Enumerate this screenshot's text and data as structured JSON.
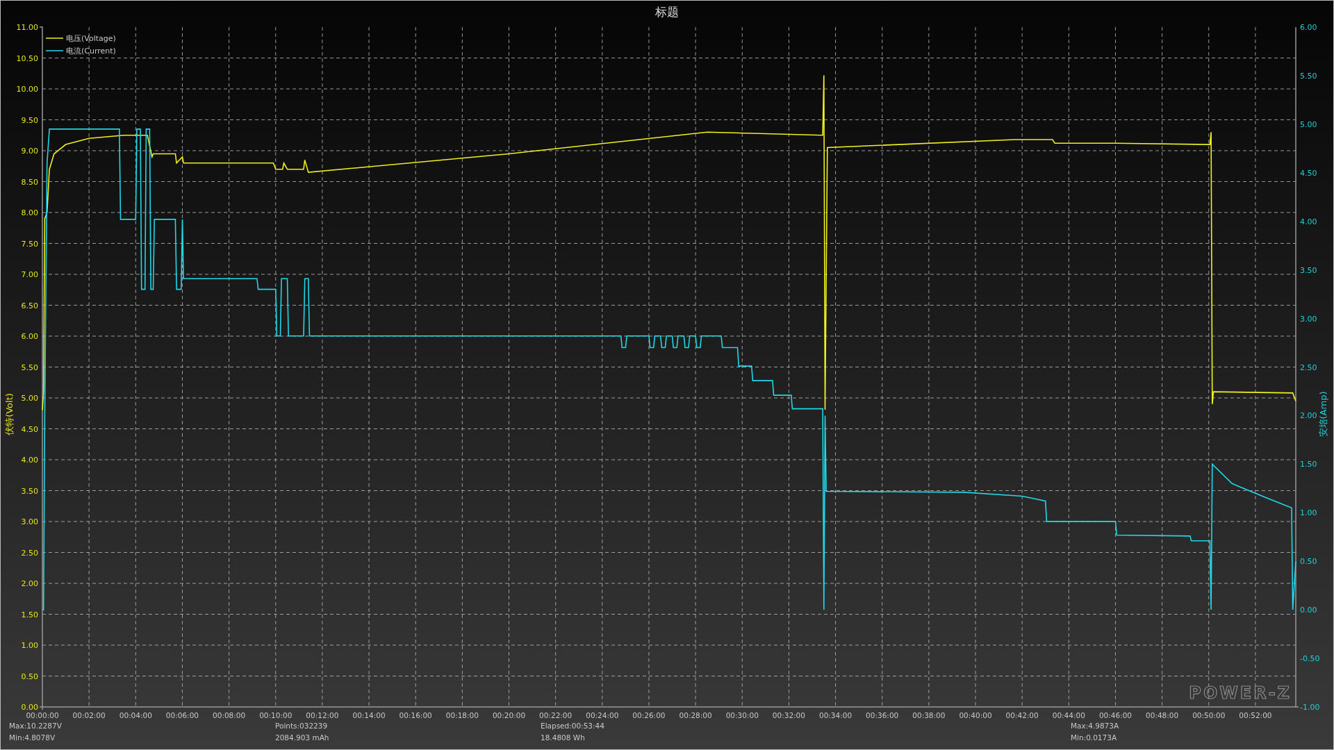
{
  "title": "标题",
  "chart": {
    "chart_data": {
      "type": "line",
      "grid": true,
      "legend": "top-left",
      "ylabel": "伏特(Volt)",
      "y2label": "安培(Amp)",
      "xlim": [
        0,
        53.73
      ],
      "ylim": [
        0,
        11
      ],
      "y2lim": [
        -1,
        6
      ],
      "xticks": [
        {
          "value": 0,
          "label": "00:00:00"
        },
        {
          "value": 2,
          "label": "00:02:00"
        },
        {
          "value": 4,
          "label": "00:04:00"
        },
        {
          "value": 6,
          "label": "00:06:00"
        },
        {
          "value": 8,
          "label": "00:08:00"
        },
        {
          "value": 10,
          "label": "00:10:00"
        },
        {
          "value": 12,
          "label": "00:12:00"
        },
        {
          "value": 14,
          "label": "00:14:00"
        },
        {
          "value": 16,
          "label": "00:16:00"
        },
        {
          "value": 18,
          "label": "00:18:00"
        },
        {
          "value": 20,
          "label": "00:20:00"
        },
        {
          "value": 22,
          "label": "00:22:00"
        },
        {
          "value": 24,
          "label": "00:24:00"
        },
        {
          "value": 26,
          "label": "00:26:00"
        },
        {
          "value": 28,
          "label": "00:28:00"
        },
        {
          "value": 30,
          "label": "00:30:00"
        },
        {
          "value": 32,
          "label": "00:32:00"
        },
        {
          "value": 34,
          "label": "00:34:00"
        },
        {
          "value": 36,
          "label": "00:36:00"
        },
        {
          "value": 38,
          "label": "00:38:00"
        },
        {
          "value": 40,
          "label": "00:40:00"
        },
        {
          "value": 42,
          "label": "00:42:00"
        },
        {
          "value": 44,
          "label": "00:44:00"
        },
        {
          "value": 46,
          "label": "00:46:00"
        },
        {
          "value": 48,
          "label": "00:48:00"
        },
        {
          "value": 50,
          "label": "00:50:00"
        },
        {
          "value": 52,
          "label": "00:52:00"
        }
      ],
      "yticks": [
        {
          "value": 0,
          "label": "0.00"
        },
        {
          "value": 0.5,
          "label": "0.50"
        },
        {
          "value": 1,
          "label": "1.00"
        },
        {
          "value": 1.5,
          "label": "1.50"
        },
        {
          "value": 2,
          "label": "2.00"
        },
        {
          "value": 2.5,
          "label": "2.50"
        },
        {
          "value": 3,
          "label": "3.00"
        },
        {
          "value": 3.5,
          "label": "3.50"
        },
        {
          "value": 4,
          "label": "4.00"
        },
        {
          "value": 4.5,
          "label": "4.50"
        },
        {
          "value": 5,
          "label": "5.00"
        },
        {
          "value": 5.5,
          "label": "5.50"
        },
        {
          "value": 6,
          "label": "6.00"
        },
        {
          "value": 6.5,
          "label": "6.50"
        },
        {
          "value": 7,
          "label": "7.00"
        },
        {
          "value": 7.5,
          "label": "7.50"
        },
        {
          "value": 8,
          "label": "8.00"
        },
        {
          "value": 8.5,
          "label": "8.50"
        },
        {
          "value": 9,
          "label": "9.00"
        },
        {
          "value": 9.5,
          "label": "9.50"
        },
        {
          "value": 10,
          "label": "10.00"
        },
        {
          "value": 10.5,
          "label": "10.50"
        },
        {
          "value": 11,
          "label": "11.00"
        }
      ],
      "y2ticks": [
        {
          "value": -1,
          "label": "-1.00"
        },
        {
          "value": -0.5,
          "label": "-0.50"
        },
        {
          "value": 0,
          "label": "0.00"
        },
        {
          "value": 0.5,
          "label": "0.50"
        },
        {
          "value": 1,
          "label": "1.00"
        },
        {
          "value": 1.5,
          "label": "1.50"
        },
        {
          "value": 2,
          "label": "2.00"
        },
        {
          "value": 2.5,
          "label": "2.50"
        },
        {
          "value": 3,
          "label": "3.00"
        },
        {
          "value": 3.5,
          "label": "3.50"
        },
        {
          "value": 4,
          "label": "4.00"
        },
        {
          "value": 4.5,
          "label": "4.50"
        },
        {
          "value": 5,
          "label": "5.00"
        },
        {
          "value": 5.5,
          "label": "5.50"
        },
        {
          "value": 6,
          "label": "6.00"
        }
      ],
      "series": [
        {
          "name": "电压(Voltage)",
          "color": "#f0f020",
          "axis": "y",
          "x": [
            0,
            0.05,
            0.1,
            0.2,
            0.3,
            0.5,
            1,
            2,
            3.5,
            4.4,
            4.5,
            4.7,
            4.75,
            5.7,
            5.75,
            6,
            6.05,
            9.9,
            10,
            10.3,
            10.35,
            10.5,
            11.2,
            11.25,
            11.4,
            20,
            28.5,
            33.45,
            33.5,
            33.55,
            33.65,
            41.7,
            43.3,
            43.4,
            46,
            50.05,
            50.1,
            50.15,
            50.2,
            53.6,
            53.73
          ],
          "values": [
            4.8,
            5.1,
            7.9,
            8.0,
            8.7,
            8.95,
            9.1,
            9.2,
            9.25,
            9.25,
            9.25,
            8.9,
            8.95,
            8.95,
            8.8,
            8.9,
            8.8,
            8.8,
            8.7,
            8.7,
            8.8,
            8.7,
            8.7,
            8.85,
            8.65,
            8.95,
            9.3,
            9.25,
            10.22,
            4.81,
            9.05,
            9.18,
            9.18,
            9.12,
            9.12,
            9.1,
            9.3,
            4.9,
            5.1,
            5.08,
            4.95
          ]
        },
        {
          "name": "电流(Current)",
          "color": "#20d8e8",
          "axis": "y2",
          "x": [
            0,
            0.05,
            0.1,
            0.2,
            0.3,
            3.3,
            3.35,
            4.0,
            4.05,
            4.2,
            4.25,
            4.4,
            4.45,
            4.6,
            4.65,
            4.75,
            4.8,
            5.7,
            5.75,
            5.95,
            6.0,
            6.05,
            9.2,
            9.25,
            10.0,
            10.05,
            10.2,
            10.25,
            10.5,
            10.55,
            11.2,
            11.25,
            11.4,
            11.45,
            24.8,
            24.85,
            25,
            25.05,
            26,
            26.05,
            26.2,
            26.25,
            26.5,
            26.55,
            26.7,
            26.75,
            27,
            27.05,
            27.2,
            27.25,
            27.5,
            27.55,
            27.7,
            27.75,
            28,
            28.05,
            28.2,
            28.25,
            29.1,
            29.15,
            29.8,
            29.85,
            30.4,
            30.45,
            31.3,
            31.35,
            32.1,
            32.15,
            33.45,
            33.5,
            33.55,
            33.6,
            39.5,
            42,
            43.0,
            43.05,
            46,
            46.05,
            49.2,
            49.25,
            50.05,
            50.1,
            50.15,
            51,
            52.5,
            53.55,
            53.6,
            53.73
          ],
          "values": [
            0,
            0,
            2.0,
            4.6,
            4.95,
            4.95,
            4.02,
            4.02,
            4.95,
            4.95,
            3.3,
            3.3,
            4.95,
            4.95,
            3.3,
            3.3,
            4.02,
            4.02,
            3.3,
            3.3,
            4.02,
            3.41,
            3.41,
            3.3,
            3.3,
            2.82,
            2.82,
            3.41,
            3.41,
            2.82,
            2.82,
            3.41,
            3.41,
            2.82,
            2.82,
            2.7,
            2.7,
            2.82,
            2.82,
            2.7,
            2.7,
            2.82,
            2.82,
            2.7,
            2.7,
            2.82,
            2.82,
            2.7,
            2.7,
            2.82,
            2.82,
            2.7,
            2.7,
            2.82,
            2.82,
            2.7,
            2.7,
            2.82,
            2.82,
            2.7,
            2.7,
            2.51,
            2.51,
            2.36,
            2.36,
            2.21,
            2.21,
            2.07,
            2.07,
            0,
            2.0,
            1.22,
            1.21,
            1.17,
            1.12,
            0.91,
            0.91,
            0.77,
            0.76,
            0.71,
            0.71,
            0,
            1.5,
            1.3,
            1.15,
            1.05,
            0,
            0.5
          ]
        }
      ]
    }
  },
  "logo": "POWER-Z",
  "stats": [
    {
      "top": "Max:10.2287V",
      "bottom": "Min:4.8078V"
    },
    {
      "top": "Points:032239",
      "bottom": "2084.903 mAh"
    },
    {
      "top": "Elapsed:00:53:44",
      "bottom": "18.4808 Wh"
    },
    {
      "top": "Max:4.9873A",
      "bottom": "Min:0.0173A"
    }
  ]
}
